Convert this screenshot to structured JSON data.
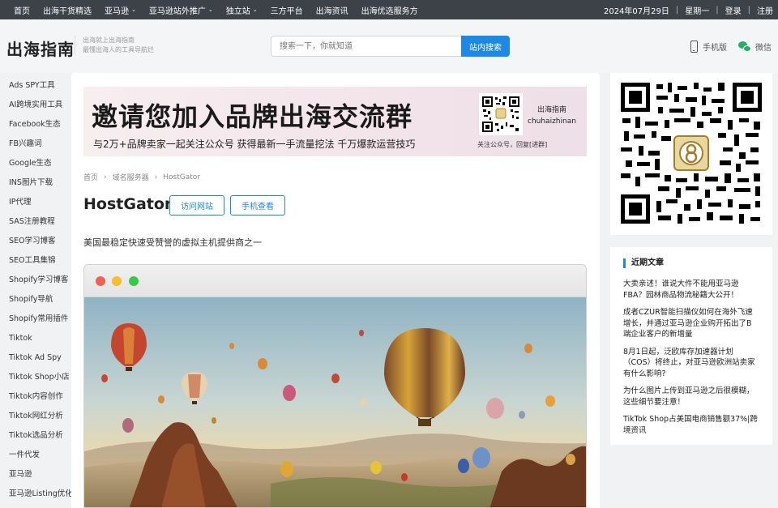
{
  "topnav": {
    "items": [
      {
        "label": "首页"
      },
      {
        "label": "出海干货精选"
      },
      {
        "label": "亚马逊",
        "caret": "⌄"
      },
      {
        "label": "亚马逊站外推广",
        "caret": "⌄"
      },
      {
        "label": "独立站",
        "caret": "⌄"
      },
      {
        "label": "三方平台"
      },
      {
        "label": "出海资讯"
      },
      {
        "label": "出海优选服务方"
      }
    ],
    "date": "2024年07月29日",
    "weekday": "星期一",
    "login": "登录",
    "register": "注册",
    "separator": "|"
  },
  "header": {
    "logo": "出海指南",
    "tagline_1": "出海就上出海指南",
    "tagline_2": "最懂出海人的工具导航烂",
    "search_placeholder": "搜索一下，你就知道",
    "search_button": "站内搜索",
    "mobile_label": "手机版",
    "wechat_label": "微信"
  },
  "sidebar": {
    "items": [
      {
        "label": "Ads SPY工具"
      },
      {
        "label": "AI跨境实用工具"
      },
      {
        "label": "Facebook生态"
      },
      {
        "label": "FB兴趣词"
      },
      {
        "label": "Google生态"
      },
      {
        "label": "INS图片下载"
      },
      {
        "label": "IP代理"
      },
      {
        "label": "SAS注册教程"
      },
      {
        "label": "SEO学习博客"
      },
      {
        "label": "SEO工具集锦"
      },
      {
        "label": "Shopify学习博客"
      },
      {
        "label": "Shopify导航"
      },
      {
        "label": "Shopify常用插件"
      },
      {
        "label": "Tiktok"
      },
      {
        "label": "Tiktok Ad Spy"
      },
      {
        "label": "Tiktok Shop小店"
      },
      {
        "label": "Tiktok内容创作"
      },
      {
        "label": "Tiktok网红分析"
      },
      {
        "label": "Tiktok选品分析"
      },
      {
        "label": "一件代发"
      },
      {
        "label": "亚马逊"
      },
      {
        "label": "亚马逊Listing优化"
      }
    ]
  },
  "banner": {
    "title": "邀请您加入品牌出海交流群",
    "subtitle": "与2万+品牌卖家一起关注公众号   获得最新一手流量挖法   千万爆款运营技巧",
    "brand_cn": "出海指南",
    "brand_en": "chuhaizhinan",
    "follow_text": "关注公众号，回复[进群]"
  },
  "breadcrumb": {
    "home": "首页",
    "category": "域名服务器",
    "current": "HostGator",
    "separator": "›"
  },
  "article": {
    "title": "HostGator",
    "visit_button": "访问网站",
    "mobile_button": "手机查看",
    "description": "美国最稳定快速受赞誉的虚拟主机提供商之一"
  },
  "recent": {
    "title": "近期文章",
    "items": [
      {
        "text": "大卖亲述！谁说大件不能用亚马逊FBA？园林商品物流秘籍大公开！"
      },
      {
        "text": "成者CZUR智能扫描仪如何在海外飞速增长，并通过亚马逊企业购开拓出了B端企业客户的新增量"
      },
      {
        "text": "8月1日起，泛欧库存加速器计划（COS）将终止，对亚马逊欧洲站卖家有什么影响?"
      },
      {
        "text": "为什么图片上传到亚马逊之后很模糊，这些细节要注意！"
      },
      {
        "text": "TikTok Shop占美国电商销售额37%|跨境资讯"
      }
    ]
  },
  "colors": {
    "accent": "#1e88e5",
    "topnav_bg": "#3d4148",
    "page_bg": "#f1f2f3"
  }
}
